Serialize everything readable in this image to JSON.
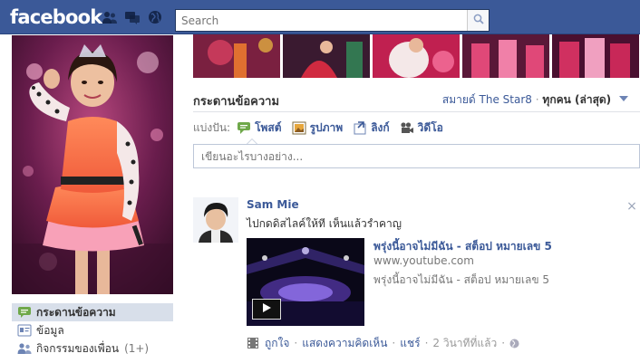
{
  "header": {
    "logo_text": "facebook",
    "search_placeholder": "Search",
    "icons": [
      "friend-requests-icon",
      "messages-icon",
      "notifications-globe-icon",
      "search-icon"
    ],
    "brand_color": "#3b5998"
  },
  "left_nav": {
    "items": [
      {
        "label": "กระดานข้อความ",
        "icon": "wall-speech-bubble-icon",
        "selected": true
      },
      {
        "label": "ข้อมูล",
        "icon": "info-card-icon",
        "selected": false
      },
      {
        "label": "กิจกรรมของเพื่อน",
        "count": "(1+)",
        "icon": "friends-activity-icon",
        "selected": false
      }
    ]
  },
  "wall": {
    "title": "กระดานข้อความ",
    "filter_owner": "สมายด์ The Star8",
    "filter_separator": "·",
    "filter_all": "ทุกคน (ล่าสุด)"
  },
  "composer": {
    "share_label": "แบ่งปัน:",
    "options": [
      {
        "label": "โพสต์",
        "icon": "status-speech-icon"
      },
      {
        "label": "รูปภาพ",
        "icon": "photo-icon"
      },
      {
        "label": "ลิงก์",
        "icon": "link-icon"
      },
      {
        "label": "วิดีโอ",
        "icon": "video-camera-icon"
      }
    ],
    "input_placeholder": "เขียนอะไรบางอย่าง..."
  },
  "story": {
    "author": "Sam Mie",
    "message": "ไปกดดิสไลค์ให้ที เห็นแล้วรำคาญ",
    "close_glyph": "×",
    "link": {
      "title": "พรุ่งนี้อาจไม่มีฉัน - สต็อป หมายเลข 5",
      "domain": "www.youtube.com",
      "description": "พรุ่งนี้อาจไม่มีฉัน - สต็อป หมายเลข 5"
    },
    "actions": {
      "like": "ถูกใจ",
      "comment": "แสดงความคิดเห็น",
      "share": "แชร์",
      "timestamp": "2 วินาทีที่แล้ว",
      "separator": "·"
    }
  }
}
